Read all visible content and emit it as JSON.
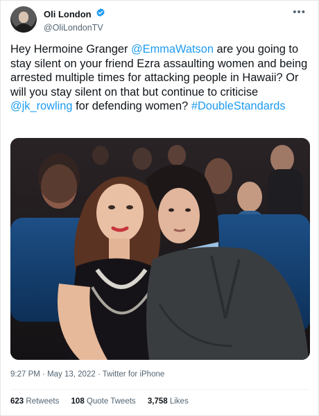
{
  "author": {
    "display_name": "Oli London",
    "handle": "@OliLondonTV",
    "verified": true
  },
  "tweet_text": {
    "part1": "Hey Hermoine Granger ",
    "mention1": "@EmmaWatson",
    "part2": " are you going to stay silent on your friend Ezra assaulting women and being arrested multiple times for attacking people in Hawaii? Or will you stay silent on that but continue to criticise ",
    "mention2": " @jk_rowling",
    "part3": "  for defending women? ",
    "hashtag": "#DoubleStandards"
  },
  "meta": {
    "time": "9:27 PM",
    "separator": " · ",
    "date": "May 13, 2022",
    "separator2": " · ",
    "source": "Twitter for iPhone"
  },
  "stats": {
    "retweets_count": "623",
    "retweets_label": " Retweets",
    "quotes_count": "108",
    "quotes_label": " Quote Tweets",
    "likes_count": "3,758",
    "likes_label": " Likes"
  },
  "colors": {
    "link": "#1d9bf0",
    "secondary_text": "#536471",
    "verified_badge": "#1d9bf0"
  }
}
